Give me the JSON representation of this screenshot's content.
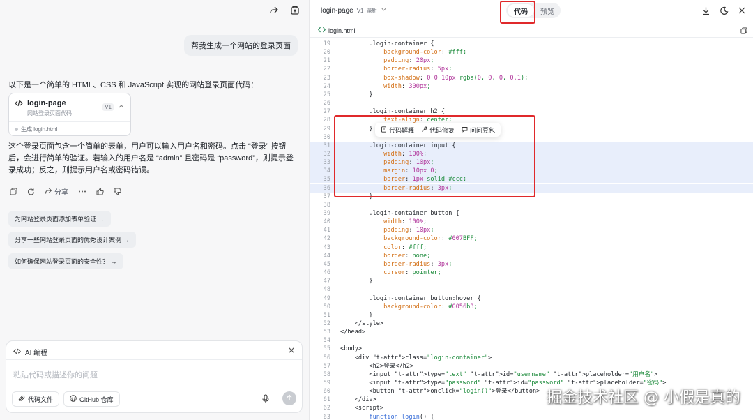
{
  "left": {
    "user_message": "帮我生成一个网站的登录页面",
    "intro": "以下是一个简单的 HTML、CSS 和 JavaScript 实现的网站登录页面代码：",
    "file_card": {
      "title": "login-page",
      "subtitle": "网站登录页面代码",
      "version": "V1",
      "status": "生成 login.html"
    },
    "answer": "这个登录页面包含一个简单的表单，用户可以输入用户名和密码。点击 “登录” 按钮后，会进行简单的验证。若输入的用户名是 “admin” 且密码是 “password”，则提示登录成功；反之，则提示用户名或密码错误。",
    "share_label": "分享",
    "suggestions": [
      "为网站登录页面添加表单验证 →",
      "分享一些网站登录页面的优秀设计案例 →",
      "如何确保网站登录页面的安全性？ →"
    ],
    "composer": {
      "header": "AI 编程",
      "placeholder": "粘贴代码或描述你的问题",
      "code_file_label": "代码文件",
      "github_label": "GitHub 仓库"
    }
  },
  "right": {
    "title": "login-page",
    "version": "V1",
    "latest": "最新",
    "tab_code": "代码",
    "tab_preview": "预览",
    "filename": "login.html",
    "popup": {
      "explain": "代码解释",
      "fix": "代码修复",
      "ask": "问问豆包"
    },
    "code_lines": [
      {
        "n": "19",
        "t": "        .login-container {"
      },
      {
        "n": "20",
        "t": "            background-color: #fff;"
      },
      {
        "n": "21",
        "t": "            padding: 20px;"
      },
      {
        "n": "22",
        "t": "            border-radius: 5px;"
      },
      {
        "n": "23",
        "t": "            box-shadow: 0 0 10px rgba(0, 0, 0, 0.1);"
      },
      {
        "n": "24",
        "t": "            width: 300px;"
      },
      {
        "n": "25",
        "t": "        }"
      },
      {
        "n": "26",
        "t": ""
      },
      {
        "n": "27",
        "t": "        .login-container h2 {"
      },
      {
        "n": "28",
        "t": "            text-align: center;"
      },
      {
        "n": "29",
        "t": "        }"
      },
      {
        "n": "30",
        "t": ""
      },
      {
        "n": "31",
        "t": "        .login-container input {"
      },
      {
        "n": "32",
        "t": "            width: 100%;"
      },
      {
        "n": "33",
        "t": "            padding: 10px;"
      },
      {
        "n": "34",
        "t": "            margin: 10px 0;"
      },
      {
        "n": "35",
        "t": "            border: 1px solid #ccc;"
      },
      {
        "n": "36",
        "t": "            border-radius: 3px;"
      },
      {
        "n": "37",
        "t": "        }"
      },
      {
        "n": "38",
        "t": ""
      },
      {
        "n": "39",
        "t": "        .login-container button {"
      },
      {
        "n": "40",
        "t": "            width: 100%;"
      },
      {
        "n": "41",
        "t": "            padding: 10px;"
      },
      {
        "n": "42",
        "t": "            background-color: #007BFF;"
      },
      {
        "n": "43",
        "t": "            color: #fff;"
      },
      {
        "n": "44",
        "t": "            border: none;"
      },
      {
        "n": "45",
        "t": "            border-radius: 3px;"
      },
      {
        "n": "46",
        "t": "            cursor: pointer;"
      },
      {
        "n": "47",
        "t": "        }"
      },
      {
        "n": "48",
        "t": ""
      },
      {
        "n": "49",
        "t": "        .login-container button:hover {"
      },
      {
        "n": "50",
        "t": "            background-color: #0056b3;"
      },
      {
        "n": "51",
        "t": "        }"
      },
      {
        "n": "52",
        "t": "    </style>"
      },
      {
        "n": "53",
        "t": "</head>"
      },
      {
        "n": "54",
        "t": ""
      },
      {
        "n": "55",
        "t": "<body>"
      },
      {
        "n": "56",
        "t": "    <div class=\"login-container\">"
      },
      {
        "n": "57",
        "t": "        <h2>登录</h2>"
      },
      {
        "n": "58",
        "t": "        <input type=\"text\" id=\"username\" placeholder=\"用户名\">"
      },
      {
        "n": "59",
        "t": "        <input type=\"password\" id=\"password\" placeholder=\"密码\">"
      },
      {
        "n": "60",
        "t": "        <button onclick=\"login()\">登录</button>"
      },
      {
        "n": "61",
        "t": "    </div>"
      },
      {
        "n": "62",
        "t": "    <script>"
      },
      {
        "n": "63",
        "t": "        function login() {"
      }
    ],
    "highlight_lines": [
      "31",
      "32",
      "33",
      "34",
      "35",
      "36"
    ]
  },
  "watermark": "掘金技术社区 @ 小假是真的",
  "colors": {
    "annotation_red": "#e0292b",
    "highlight": "#e8eefb"
  }
}
